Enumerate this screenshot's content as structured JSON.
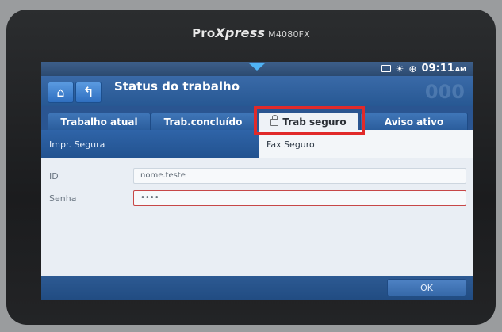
{
  "device": {
    "brand_pro": "Pro",
    "brand_xpress": "Xpress",
    "model": "M4080FX"
  },
  "statusbar": {
    "time": "09:11",
    "ampm": "AM"
  },
  "header": {
    "title": "Status do trabalho",
    "counter": "000"
  },
  "tabs": [
    {
      "label": "Trabalho atual"
    },
    {
      "label": "Trab.concluído"
    },
    {
      "label": "Trab seguro"
    },
    {
      "label": "Aviso ativo"
    }
  ],
  "subtabs": [
    {
      "label": "Impr. Segura"
    },
    {
      "label": "Fax Seguro"
    }
  ],
  "form": {
    "id_label": "ID",
    "id_value": "nome.teste",
    "password_label": "Senha",
    "password_value": "••••"
  },
  "footer": {
    "ok_label": "OK"
  },
  "colors": {
    "highlight": "#e12a2a",
    "header_blue": "#275893",
    "status_arrow": "#4fb3f5"
  }
}
